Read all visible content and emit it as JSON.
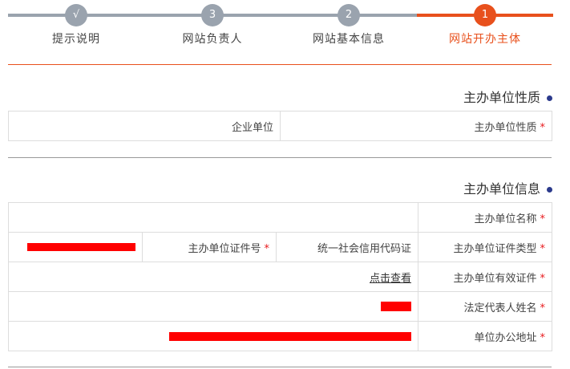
{
  "steps": [
    {
      "num": "√",
      "label": "提示说明"
    },
    {
      "num": "3",
      "label": "网站负责人"
    },
    {
      "num": "2",
      "label": "网站基本信息"
    },
    {
      "num": "1",
      "label": "网站开办主体"
    }
  ],
  "section1": {
    "title": "主办单位性质",
    "field_label": "主办单位性质",
    "field_value": "企业单位"
  },
  "section2": {
    "title": "主办单位信息",
    "rows": {
      "name_label": "主办单位名称",
      "cert_type_label": "主办单位证件类型",
      "cert_type_value": "统一社会信用代码证",
      "cert_no_label": "主办单位证件号",
      "valid_cert_label": "主办单位有效证件",
      "valid_cert_link": "点击查看",
      "legal_rep_label": "法定代表人姓名",
      "address_label": "单位办公地址"
    }
  },
  "colors": {
    "accent": "#e8501c",
    "inactive": "#9aa3ae",
    "required": "#e8191c",
    "redaction": "#ff0000"
  }
}
